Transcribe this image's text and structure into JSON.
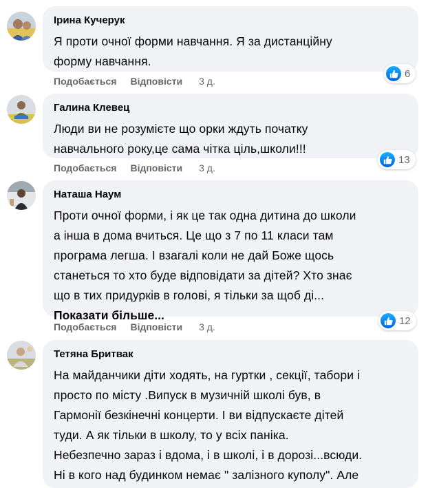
{
  "comments": [
    {
      "author": "Ірина Кучерук",
      "lines": [
        "Я проти очної форми навчання. Я за дистанційну",
        "форму навчання."
      ],
      "like_label": "Подобається",
      "reply_label": "Відповісти",
      "time": "3 д.",
      "reactions": "6"
    },
    {
      "author": "Галина Клевец",
      "lines": [
        "Люди ви не розумієте що орки ждуть початку",
        "навчального року,це сама чітка ціль,школи!!!"
      ],
      "like_label": "Подобається",
      "reply_label": "Відповісти",
      "time": "3 д.",
      "reactions": "13"
    },
    {
      "author": "Наташа Наум",
      "lines": [
        "Проти очної форми, і як це так одна дитина до школи",
        "а інша в дома вчиться. Це що з 7 по 11 класи там",
        "програма легша. І взагалі коли не дай Боже щось",
        "станеться то хто буде відповідати за дітей? Хто знає",
        "що в тих придурків в голові, я тільки за щоб ді..."
      ],
      "see_more": "Показати більше...",
      "like_label": "Подобається",
      "reply_label": "Відповісти",
      "time": "3 д.",
      "reactions": "12"
    },
    {
      "author": "Тетяна Бритвак",
      "lines": [
        "На майданчики діти ходять, на гуртки , секції, табори і",
        "просто по місту .Випуск в музичній школі був, в",
        "Гармонії безкінечні концерти. І ви відпускаєте дітей",
        "туди. А як тільки в школу, то у всіх паніка.",
        "Небезпечно зараз і вдома, і в школі, і в дорозі...всюди.",
        "Ні в кого над будинком немає \" залізного куполу\". Але"
      ]
    }
  ],
  "colors": {
    "bubble": "#f0f2f5",
    "text": "#050505",
    "meta": "#65676b",
    "like_blue": "#1877f2"
  },
  "icons": {
    "reaction": "like-thumb-icon"
  }
}
